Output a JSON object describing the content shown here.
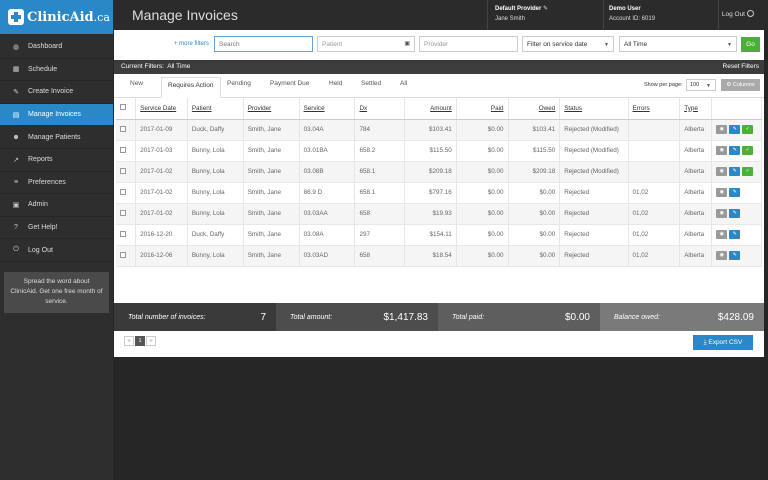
{
  "app": {
    "logo_name": "ClinicAid",
    "logo_tld": ".ca",
    "page_title": "Manage Invoices"
  },
  "header": {
    "provider_label": "Default Provider",
    "provider_name": "Jane Smith",
    "user_label": "Demo User",
    "account_id": "Account ID: 6019",
    "logout_label": "Log Out"
  },
  "sidebar": {
    "items": [
      {
        "label": "Dashboard",
        "icon": "dashboard-icon",
        "glyph": "◍"
      },
      {
        "label": "Schedule",
        "icon": "calendar-icon",
        "glyph": "▦"
      },
      {
        "label": "Create Invoice",
        "icon": "edit-icon",
        "glyph": "✎"
      },
      {
        "label": "Manage Invoices",
        "icon": "invoices-icon",
        "glyph": "▤"
      },
      {
        "label": "Manage Patients",
        "icon": "user-icon",
        "glyph": "☻"
      },
      {
        "label": "Reports",
        "icon": "chart-icon",
        "glyph": "↗"
      },
      {
        "label": "Preferences",
        "icon": "sliders-icon",
        "glyph": "≡"
      },
      {
        "label": "Admin",
        "icon": "lock-icon",
        "glyph": "▣"
      },
      {
        "label": "Get Help!",
        "icon": "help-icon",
        "glyph": "?"
      },
      {
        "label": "Log Out",
        "icon": "logout-icon",
        "glyph": "⏻"
      }
    ],
    "promo": "Spread the word about ClinicAid. Get one free month of service."
  },
  "filters": {
    "more_filters": "+ more filters",
    "search_placeholder": "Search",
    "patient_placeholder": "Patient",
    "provider_placeholder": "Provider",
    "service_filter_value": "Filter on service date",
    "range_value": "All Time",
    "go_label": "Go",
    "current_filters": "Current Filters:",
    "current_filters_value": "All Time",
    "reset_label": "Reset Filters"
  },
  "tabs": [
    "New",
    "Requires Action",
    "Pending",
    "Payment Due",
    "Held",
    "Settled",
    "All"
  ],
  "active_tab": "Requires Action",
  "paging": {
    "show_per_page_label": "Show per page:",
    "per_page_value": "100",
    "columns_label": "Columns",
    "current_page": "1",
    "prev": "«",
    "next": "»"
  },
  "table": {
    "headers": [
      "Service Date",
      "Patient",
      "Provider",
      "Service",
      "Dx",
      "Amount",
      "Paid",
      "Owed",
      "Status",
      "Errors",
      "Type"
    ],
    "rows": [
      {
        "date": "2017-01-09",
        "patient": "Duck, Daffy",
        "provider": "Smith, Jane",
        "service": "03.04A",
        "dx": "784",
        "amount": "$103.41",
        "paid": "$0.00",
        "owed": "$103.41",
        "status": "Rejected (Modified)",
        "errors": "",
        "type": "Alberta",
        "ok": true
      },
      {
        "date": "2017-01-03",
        "patient": "Bunny, Lola",
        "provider": "Smith, Jane",
        "service": "03.01BA",
        "dx": "658.2",
        "amount": "$115.50",
        "paid": "$0.00",
        "owed": "$115.50",
        "status": "Rejected (Modified)",
        "errors": "",
        "type": "Alberta",
        "ok": true
      },
      {
        "date": "2017-01-02",
        "patient": "Bunny, Lola",
        "provider": "Smith, Jane",
        "service": "03.08B",
        "dx": "658.1",
        "amount": "$209.18",
        "paid": "$0.00",
        "owed": "$209.18",
        "status": "Rejected (Modified)",
        "errors": "",
        "type": "Alberta",
        "ok": true
      },
      {
        "date": "2017-01-02",
        "patient": "Bunny, Lola",
        "provider": "Smith, Jane",
        "service": "86.9 D",
        "dx": "658.1",
        "amount": "$797.16",
        "paid": "$0.00",
        "owed": "$0.00",
        "status": "Rejected",
        "errors": "01,02",
        "type": "Alberta",
        "ok": false
      },
      {
        "date": "2017-01-02",
        "patient": "Bunny, Lola",
        "provider": "Smith, Jane",
        "service": "03.03AA",
        "dx": "658",
        "amount": "$19.93",
        "paid": "$0.00",
        "owed": "$0.00",
        "status": "Rejected",
        "errors": "01,02",
        "type": "Alberta",
        "ok": false
      },
      {
        "date": "2016-12-20",
        "patient": "Duck, Daffy",
        "provider": "Smith, Jane",
        "service": "03.08A",
        "dx": "297",
        "amount": "$154.11",
        "paid": "$0.00",
        "owed": "$0.00",
        "status": "Rejected",
        "errors": "01,02",
        "type": "Alberta",
        "ok": false
      },
      {
        "date": "2016-12-06",
        "patient": "Bunny, Lola",
        "provider": "Smith, Jane",
        "service": "03.03AD",
        "dx": "658",
        "amount": "$18.54",
        "paid": "$0.00",
        "owed": "$0.00",
        "status": "Rejected",
        "errors": "01,02",
        "type": "Alberta",
        "ok": false
      }
    ]
  },
  "totals": {
    "count_label": "Total number of invoices:",
    "count_value": "7",
    "amount_label": "Total amount:",
    "amount_value": "$1,417.83",
    "paid_label": "Total paid:",
    "paid_value": "$0.00",
    "owed_label": "Balance owed:",
    "owed_value": "$428.09"
  },
  "export_label": "Export CSV",
  "colors": {
    "accent": "#2a88c8",
    "success": "#4caf38",
    "totals_bg": [
      "#3a3a3a",
      "#4d4d4d",
      "#5e5e5e",
      "#7a7a7a"
    ]
  }
}
